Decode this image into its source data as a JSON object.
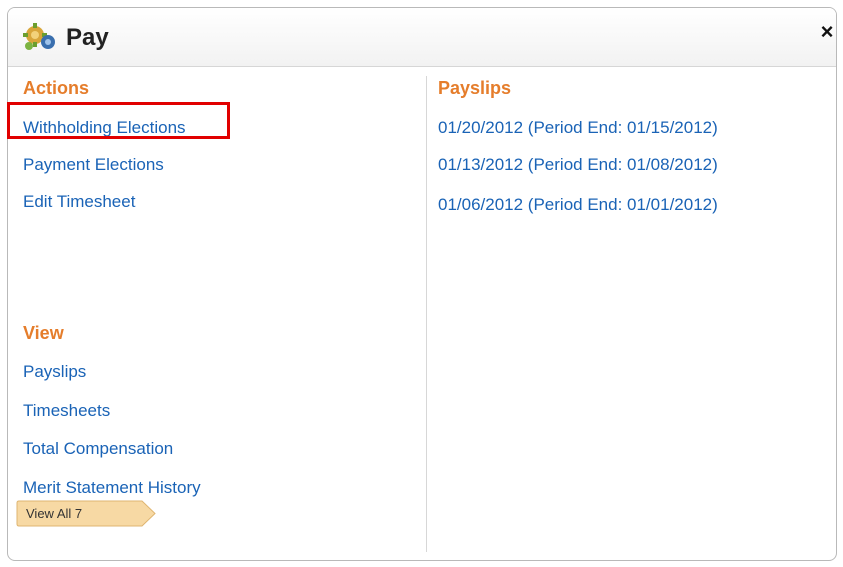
{
  "header": {
    "title": "Pay",
    "icon": "pay-gears-icon",
    "close_label": "×"
  },
  "actions": {
    "title": "Actions",
    "items": [
      "Withholding Elections",
      "Payment Elections",
      "Edit Timesheet"
    ]
  },
  "view": {
    "title": "View",
    "items": [
      "Payslips",
      "Timesheets",
      "Total Compensation",
      "Merit Statement History"
    ],
    "view_all": "View All 7"
  },
  "payslips": {
    "title": "Payslips",
    "items": [
      "01/20/2012 (Period End: 01/15/2012)",
      "01/13/2012 (Period End: 01/08/2012)",
      "01/06/2012 (Period End: 01/01/2012)"
    ]
  },
  "colors": {
    "accent_orange": "#e57d2b",
    "link_blue": "#1a63b6",
    "highlight_red": "#e10000"
  }
}
